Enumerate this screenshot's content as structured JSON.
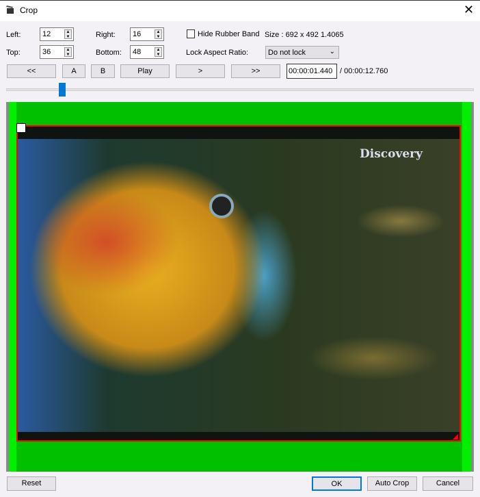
{
  "window": {
    "title": "Crop",
    "close": "✕"
  },
  "fields": {
    "left_label": "Left:",
    "left": "12",
    "right_label": "Right:",
    "right": "16",
    "top_label": "Top:",
    "top": "36",
    "bottom_label": "Bottom:",
    "bottom": "48"
  },
  "hide_rubber_band": {
    "label": "Hide Rubber Band",
    "checked": false
  },
  "size_text": "Size : 692 x 492  1.4065",
  "lock": {
    "label": "Lock Aspect Ratio:",
    "value": "Do not lock"
  },
  "transport": {
    "first": "<<",
    "a": "A",
    "b": "B",
    "play": "Play",
    "next": ">",
    "last": ">>",
    "current_time": "00:00:01.440",
    "total_time": "/ 00:00:12.760"
  },
  "slider": {
    "position_percent": 11
  },
  "preview": {
    "logo": "Discovery"
  },
  "footer": {
    "reset": "Reset",
    "ok": "OK",
    "auto_crop": "Auto Crop",
    "cancel": "Cancel"
  }
}
